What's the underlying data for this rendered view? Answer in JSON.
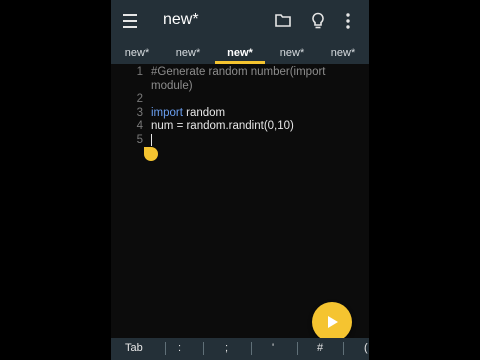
{
  "header": {
    "title": "new*"
  },
  "tabs": [
    "new*",
    "new*",
    "new*",
    "new*",
    "new*"
  ],
  "active_tab_index": 2,
  "editor": {
    "line_numbers": [
      "1",
      "",
      "2",
      "3",
      "4",
      "5"
    ],
    "lines": {
      "l1": "#Generate random number(import",
      "l1b": "module)",
      "l3_kw": "import",
      "l3_rest": " random",
      "l4": "num = random.randint(0,10)"
    }
  },
  "symbol_bar": [
    "Tab",
    ":",
    ";",
    "'",
    "#",
    "("
  ],
  "colors": {
    "accent": "#f5c430",
    "appbar": "#243038",
    "keyword": "#6a9ff0"
  },
  "icons": [
    "menu-icon",
    "folder-icon",
    "lightbulb-icon",
    "more-vert-icon",
    "play-icon"
  ]
}
